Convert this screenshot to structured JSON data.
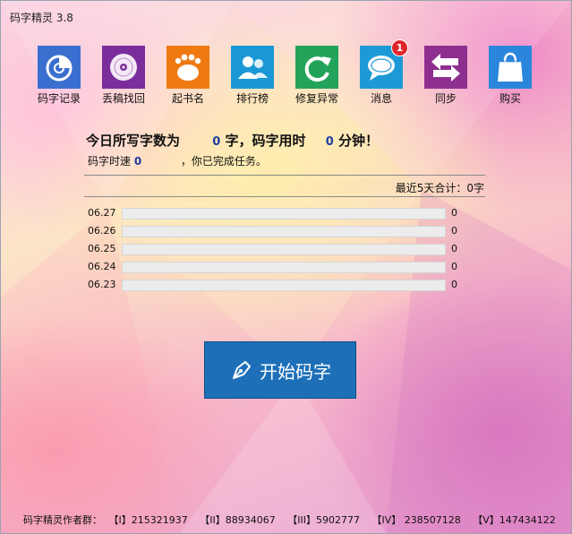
{
  "window": {
    "title": "码字精灵 3.8"
  },
  "toolbar": [
    {
      "label": "码字记录",
      "icon": "chart-circle-icon",
      "color": "#3a6fd0"
    },
    {
      "label": "丢稿找回",
      "icon": "disc-icon",
      "color": "#7b2d9b"
    },
    {
      "label": "起书名",
      "icon": "footprint-icon",
      "color": "#f07a12"
    },
    {
      "label": "排行榜",
      "icon": "users-icon",
      "color": "#1a98d5"
    },
    {
      "label": "修复异常",
      "icon": "refresh-icon",
      "color": "#23a35a"
    },
    {
      "label": "消息",
      "icon": "chat-bubble-icon",
      "color": "#1d9ad6",
      "badge": "1"
    },
    {
      "label": "同步",
      "icon": "sync-arrows-icon",
      "color": "#8e2f8f"
    },
    {
      "label": "购买",
      "icon": "shopping-bag-icon",
      "color": "#2b86db"
    }
  ],
  "stats": {
    "headline_prefix": "今日所写字数为",
    "word_count": "0",
    "headline_mid": "字，码字用时",
    "minutes": "0",
    "headline_suffix": "分钟！",
    "speed_label": "码字时速",
    "speed": "0",
    "task_text": "，你已完成任务。"
  },
  "summary": {
    "label": "最近5天合计：",
    "total": "0",
    "unit": "字"
  },
  "daily": [
    {
      "date": "06.27",
      "value": "0",
      "progress": 0
    },
    {
      "date": "06.26",
      "value": "0",
      "progress": 0
    },
    {
      "date": "06.25",
      "value": "0",
      "progress": 0
    },
    {
      "date": "06.24",
      "value": "0",
      "progress": 0
    },
    {
      "date": "06.23",
      "value": "0",
      "progress": 0
    }
  ],
  "start_button": {
    "label": "开始码字",
    "icon": "pen-nib-icon"
  },
  "footer": {
    "label": "码字精灵作者群：",
    "groups": [
      "【I】215321937",
      "【II】88934067",
      "【III】5902777",
      "【IV】 238507128",
      "【V】147434122"
    ]
  }
}
